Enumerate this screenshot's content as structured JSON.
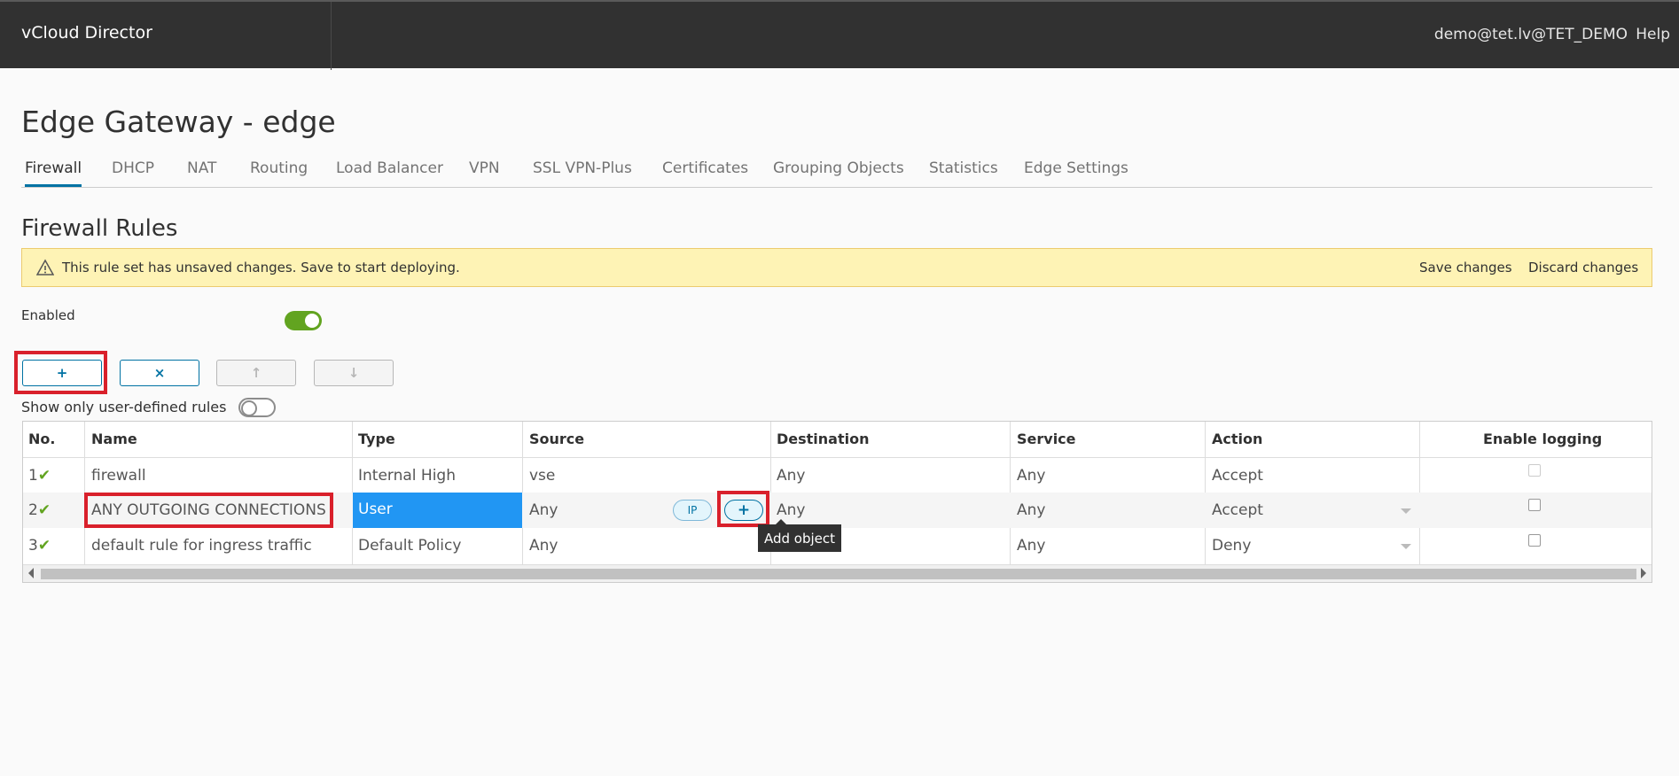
{
  "header": {
    "brand": "vCloud Director",
    "user": "demo@tet.lv@TET_DEMO",
    "help": "Help"
  },
  "page": {
    "title": "Edge Gateway - edge"
  },
  "tabs": [
    {
      "label": "Firewall",
      "active": true
    },
    {
      "label": "DHCP"
    },
    {
      "label": "NAT"
    },
    {
      "label": "Routing"
    },
    {
      "label": "Load Balancer"
    },
    {
      "label": "VPN"
    },
    {
      "label": "SSL VPN-Plus"
    },
    {
      "label": "Certificates"
    },
    {
      "label": "Grouping Objects"
    },
    {
      "label": "Statistics"
    },
    {
      "label": "Edge Settings"
    }
  ],
  "section": {
    "title": "Firewall Rules"
  },
  "banner": {
    "text": "This rule set has unsaved changes. Save to start deploying.",
    "save": "Save changes",
    "discard": "Discard changes"
  },
  "enabled": {
    "label": "Enabled",
    "on": true
  },
  "toolbar": {
    "add": "+",
    "delete": "×",
    "up": "↑",
    "down": "↓"
  },
  "user_defined": {
    "label": "Show only user-defined rules",
    "on": false
  },
  "table": {
    "headers": [
      "No.",
      "Name",
      "Type",
      "Source",
      "Destination",
      "Service",
      "Action",
      "Enable logging"
    ],
    "rows": [
      {
        "no": "1",
        "name": "firewall",
        "type": "Internal High",
        "source": "vse",
        "destination": "Any",
        "service": "Any",
        "action": "Accept"
      },
      {
        "no": "2",
        "name": "ANY OUTGOING CONNECTIONS",
        "type": "User",
        "source": "Any",
        "destination": "Any",
        "service": "Any",
        "action": "Accept"
      },
      {
        "no": "3",
        "name": "default rule for ingress traffic",
        "type": "Default Policy",
        "source": "Any",
        "destination": "",
        "service": "Any",
        "action": "Deny"
      }
    ],
    "ip_pill": "IP",
    "add_pill": "+"
  },
  "tooltip": {
    "text": "Add object"
  },
  "colors": {
    "header_bg": "#313131",
    "accent": "#0072a3",
    "success": "#62a420",
    "highlight": "#d9202b",
    "selected": "#2196f3",
    "banner_bg": "#fef3b5"
  }
}
